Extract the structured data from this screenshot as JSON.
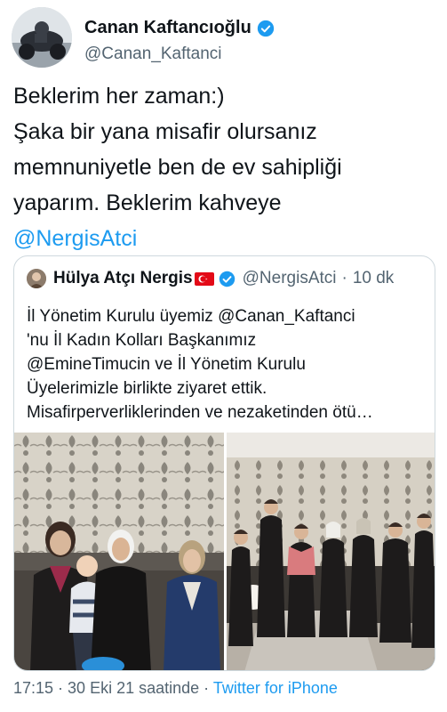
{
  "author": {
    "display_name": "Canan Kaftancıoğlu",
    "handle": "@Canan_Kaftanci"
  },
  "tweet": {
    "lines": [
      "Beklerim her zaman:)",
      "Şaka bir yana misafir olursanız",
      "memnuniyetle ben de ev sahipliği",
      "yaparım. Beklerim kahveye"
    ],
    "mention": "@NergisAtci"
  },
  "quote": {
    "display_name": "Hülya Atçı Nergis",
    "handle": "@NergisAtci",
    "separator": "·",
    "time": "10 dk",
    "lines": [
      "İl Yönetim Kurulu üyemiz @Canan_Kaftanci",
      "'nu İl Kadın Kolları Başkanımız",
      "@EmineTimucin ve İl Yönetim Kurulu",
      "Üyelerimizle birlikte ziyaret ettik.",
      "Misafirperverliklerinden ve nezaketinden ötü…"
    ]
  },
  "footer": {
    "timestamp": "17:15 · 30 Eki 21 saatinde ·",
    "source": "Twitter for iPhone"
  },
  "colors": {
    "link": "#1d9bf0",
    "secondary_text": "#536471",
    "border": "#cfd9de"
  }
}
